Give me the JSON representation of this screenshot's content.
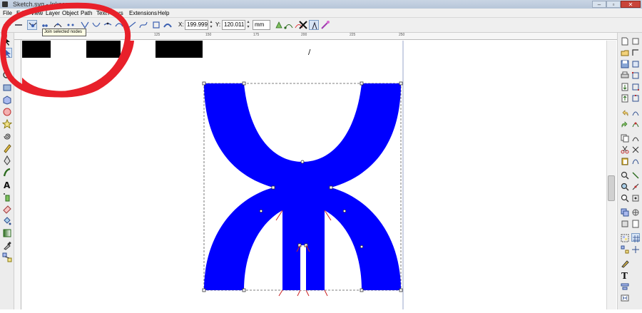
{
  "window": {
    "title": "Sketch.svg - Inkscape",
    "minimize": "–",
    "maximize": "▫",
    "close": "✕"
  },
  "menubar": {
    "items": [
      "File",
      "Edit",
      "View",
      "Layer",
      "Object",
      "Path",
      "Text",
      "Filters",
      "Extensions",
      "Help"
    ]
  },
  "node_toolbar": {
    "x_label": "X:",
    "x_value": "199.999",
    "y_label": "Y:",
    "y_value": "120.011",
    "unit": "mm"
  },
  "tooltip": {
    "text": "Join selected nodes"
  },
  "ruler": {
    "ticks": [
      "100",
      "125",
      "150",
      "175",
      "200",
      "225",
      "250"
    ]
  },
  "canvas": {
    "slash_text": "/",
    "shape_color": "#0000ff"
  },
  "icons": {
    "left_tools": [
      "selector-icon",
      "node-editor-icon",
      "tweak-icon",
      "zoom-icon",
      "rectangle-icon",
      "3d-box-icon",
      "ellipse-icon",
      "star-icon",
      "spiral-icon",
      "pencil-icon",
      "pen-icon",
      "calligraphy-icon",
      "text-icon",
      "spray-icon",
      "eraser-icon",
      "paint-bucket-icon",
      "gradient-icon",
      "mesh-icon",
      "dropper-icon",
      "connector-icon"
    ],
    "right_commands": [
      "new-document-icon",
      "open-icon",
      "save-icon",
      "print-icon",
      "import-icon",
      "export-icon",
      "undo-icon",
      "redo-icon",
      "copy-icon",
      "cut-icon",
      "paste-icon",
      "zoom-selection-icon",
      "zoom-drawing-icon",
      "zoom-page-icon",
      "duplicate-icon",
      "clone-icon",
      "group-icon",
      "ungroup-icon",
      "fill-stroke-icon",
      "text-font-icon",
      "align-icon",
      "xml-editor-icon"
    ]
  },
  "annotation_color": "#e8202a"
}
